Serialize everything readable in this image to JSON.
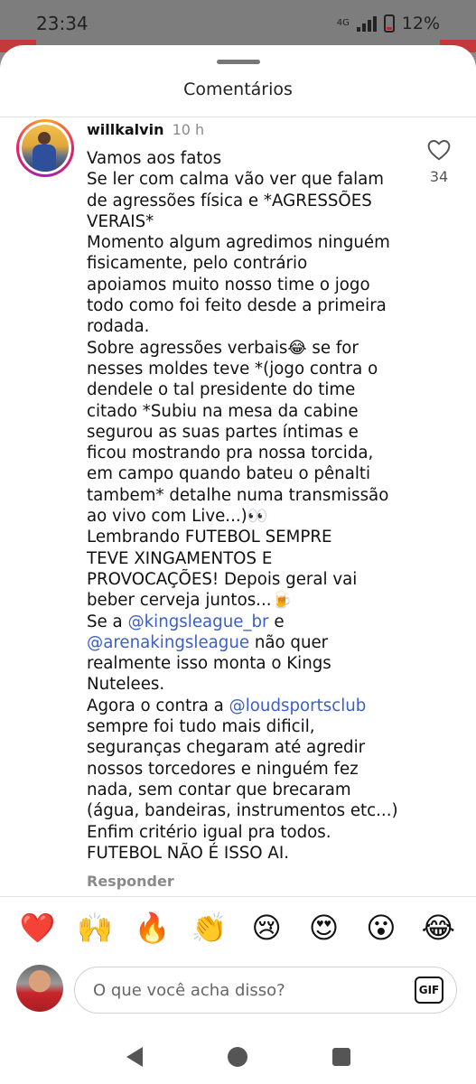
{
  "status_bar": {
    "time": "23:34",
    "network": "4G",
    "battery": "12%"
  },
  "sheet": {
    "title": "Comentários"
  },
  "comment": {
    "username": "willkalvin",
    "time": "10 h",
    "likes": "34",
    "lines": [
      "Vamos aos fatos",
      "Se ler com calma vão ver que falam",
      "de agressões física e *AGRESSÕES",
      "VERAIS*",
      "Momento algum agredimos ninguém",
      "fisicamente, pelo contrário",
      "apoiamos muito nosso time o jogo",
      "todo como foi feito desde a primeira",
      "rodada.",
      "Sobre agressões verbais😂 se for",
      "nesses moldes teve *(jogo contra o",
      "dendele o tal presidente do time",
      "citado *Subiu na mesa da cabine",
      "segurou as suas partes íntimas e",
      "ficou mostrando pra nossa torcida,",
      "em campo quando bateu o pênalti",
      "tambem* detalhe numa transmissão",
      "ao vivo com Live...)👀",
      "Lembrando FUTEBOL SEMPRE",
      "TEVE XINGAMENTOS E",
      "PROVOCAÇÕES! Depois geral vai",
      "beber cerveja juntos...🍺",
      "Se a ",
      "kingsleague_br",
      " e",
      "arenakingsleague",
      " não quer",
      "realmente isso monta o Kings",
      "Nutelees.",
      "Agora o contra a ",
      "loudsportsclub",
      "sempre foi tudo mais dificil,",
      "seguranças chegaram até agredir",
      "nossos torcedores e ninguém fez",
      "nada, sem contar que brecaram",
      "(água, bandeiras, instrumentos etc...)",
      "Enfim critério igual pra todos.",
      "FUTEBOL NÃO É ISSO AI."
    ],
    "mention_prefix": "@",
    "reply_label": "Responder"
  },
  "emoji_bar": [
    "❤️",
    "🙌",
    "🔥",
    "👏",
    "😢",
    "😍",
    "😮",
    "😂"
  ],
  "input": {
    "placeholder": "O que você acha disso?",
    "gif_label": "GIF"
  },
  "icons": {
    "like": "heart-outline-icon",
    "gif": "gif-icon",
    "nav_back": "back-triangle-icon",
    "nav_home": "home-circle-icon",
    "nav_recent": "recents-square-icon"
  }
}
